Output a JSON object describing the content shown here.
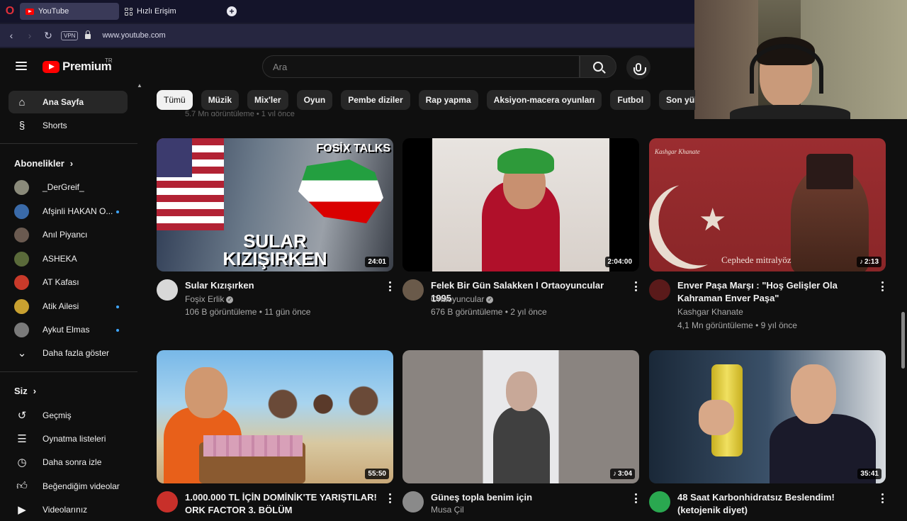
{
  "browser": {
    "tabs": [
      {
        "label": "YouTube",
        "active": true
      },
      {
        "label": "Hızlı Erişim",
        "active": false
      }
    ],
    "url": "www.youtube.com",
    "vpn_label": "VPN"
  },
  "masthead": {
    "logo_text": "Premium",
    "region": "TR",
    "search_placeholder": "Ara"
  },
  "sidebar": {
    "main": [
      {
        "label": "Ana Sayfa",
        "icon": "home-icon"
      },
      {
        "label": "Shorts",
        "icon": "shorts-icon"
      }
    ],
    "subscriptions_header": "Abonelikler",
    "subscriptions": [
      {
        "label": "_DerGreif_",
        "color": "#8a8a7a",
        "new": false
      },
      {
        "label": "Afşinli HAKAN O...",
        "color": "#3a6aa8",
        "new": true
      },
      {
        "label": "Anıl Piyancı",
        "color": "#6a5a50",
        "new": false
      },
      {
        "label": "ASHEKA",
        "color": "#5a6a3a",
        "new": false
      },
      {
        "label": "AT Kafası",
        "color": "#c83a2a",
        "new": false
      },
      {
        "label": "Atik Ailesi",
        "color": "#c8a030",
        "new": true
      },
      {
        "label": "Aykut Elmas",
        "color": "#7a7a7a",
        "new": true
      }
    ],
    "show_more": "Daha fazla göster",
    "you_header": "Siz",
    "you_items": [
      {
        "label": "Geçmiş",
        "icon": "history-icon"
      },
      {
        "label": "Oynatma listeleri",
        "icon": "playlist-icon"
      },
      {
        "label": "Daha sonra izle",
        "icon": "clock-icon"
      },
      {
        "label": "Beğendiğim videolar",
        "icon": "thumbs-up-icon"
      },
      {
        "label": "Videolarınız",
        "icon": "video-icon"
      }
    ]
  },
  "chips": [
    "Tümü",
    "Müzik",
    "Mix'ler",
    "Oyun",
    "Pembe diziler",
    "Rap yapma",
    "Aksiyon-macera oyunları",
    "Futbol",
    "Son yüklenenler"
  ],
  "ghost_meta": "5,7 Mn görüntüleme • 1 yıl önce",
  "videos": [
    {
      "title": "Sular Kızışırken",
      "channel": "Foşix Erlik",
      "verified": true,
      "meta": "106 B görüntüleme • 11 gün önce",
      "duration": "24:01",
      "music": false,
      "thumb_text_1": "FOSİX TALKS",
      "thumb_text_2": "SULAR",
      "thumb_text_3": "KIZIŞIRKEN",
      "avatar_color": "#d8d8d8"
    },
    {
      "title": "Felek Bir Gün Salakken  I Ortaoyuncular 1995",
      "channel": "Ortaoyuncular",
      "verified": true,
      "meta": "676 B görüntüleme • 2 yıl önce",
      "duration": "2:04:00",
      "music": false,
      "avatar_color": "#6a5a4a"
    },
    {
      "title": "Enver Paşa Marşı : \"Hoş Gelişler Ola Kahraman Enver Paşa\"",
      "channel": "Kashgar Khanate",
      "verified": false,
      "meta": "4,1 Mn görüntüleme • 9 yıl önce",
      "duration": "2:13",
      "music": true,
      "thumb_brand": "Kashgar Khanate",
      "thumb_caption": "Cephede mitralyöz",
      "avatar_color": "#5a1a1a"
    },
    {
      "title": "1.000.000 TL İÇİN DOMİNİK'TE YARIŞTILAR! ORK FACTOR 3. BÖLÜM",
      "channel": "",
      "verified": false,
      "meta": "",
      "duration": "55:50",
      "music": false,
      "avatar_color": "#c8302a"
    },
    {
      "title": "Güneş topla benim için",
      "channel": "Musa Çil",
      "verified": false,
      "meta": "",
      "duration": "3:04",
      "music": true,
      "avatar_color": "#8a8a8a"
    },
    {
      "title": "48 Saat Karbonhidratsız Beslendim! (ketojenik diyet)",
      "channel": "",
      "verified": false,
      "meta": "",
      "duration": "35:41",
      "music": false,
      "avatar_color": "#2aa850"
    }
  ]
}
